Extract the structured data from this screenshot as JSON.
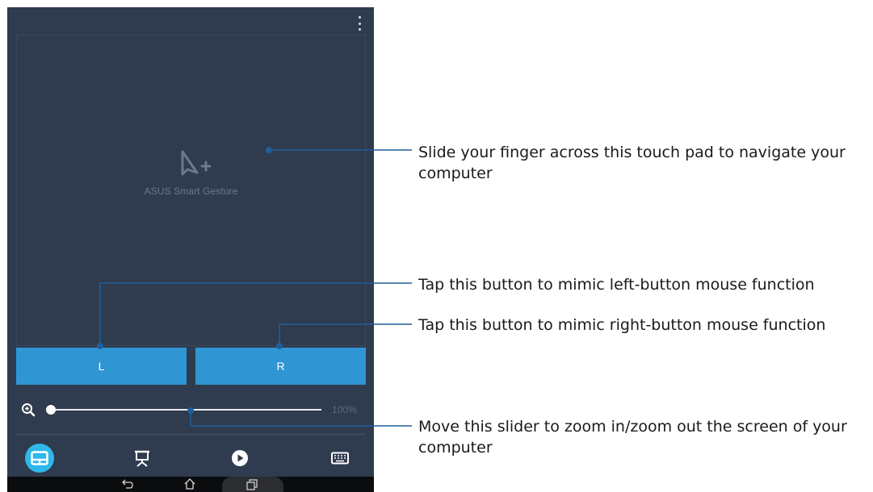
{
  "app": {
    "menu_icon": "more-vert-icon",
    "touchpad_icon": "gesture-cursor-icon",
    "touchpad_label": "ASUS Smart Gesture",
    "left_button_label": "L",
    "right_button_label": "R",
    "zoom_icon": "zoom-in-icon",
    "zoom_value": "100%",
    "zoom_level_fraction": 0.0,
    "nav": [
      {
        "name": "touchpad",
        "icon": "touchpad-icon",
        "active": true
      },
      {
        "name": "presentation",
        "icon": "presentation-icon",
        "active": false
      },
      {
        "name": "media",
        "icon": "play-icon",
        "active": false
      },
      {
        "name": "keyboard",
        "icon": "keyboard-icon",
        "active": false
      }
    ],
    "system_bar": [
      "back-icon",
      "home-icon",
      "recent-apps-icon"
    ]
  },
  "callouts": {
    "touchpad": "Slide your finger across this touch pad to navigate your computer",
    "left_button": "Tap this button to mimic left-button mouse function",
    "right_button": "Tap this button to mimic right-button mouse function",
    "slider": "Move this slider to zoom in/zoom out the screen of your computer"
  },
  "colors": {
    "screen_bg": "#2f3b4e",
    "button_blue": "#2f96d3",
    "active_nav": "#2fb8ea",
    "callout_line": "#1f5f9c"
  }
}
